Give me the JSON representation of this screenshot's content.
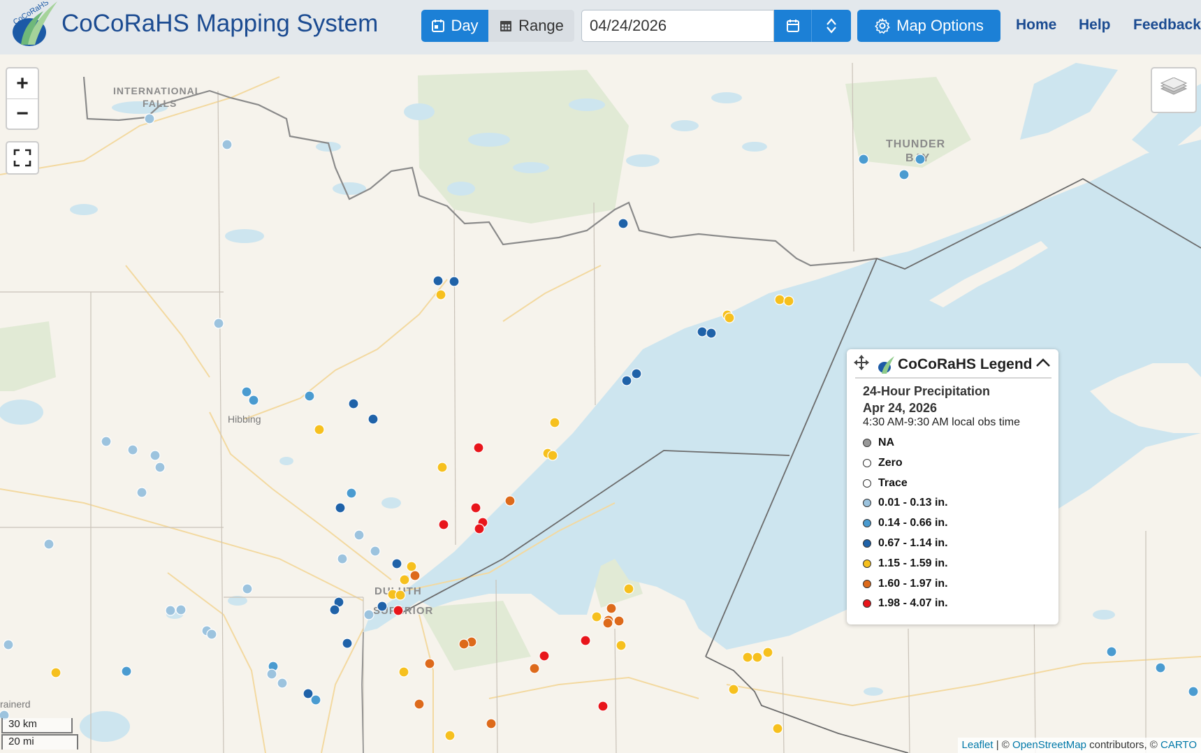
{
  "header": {
    "app_title": "CoCoRaHS Mapping System",
    "day_label": "Day",
    "range_label": "Range",
    "date_value": "04/24/2026",
    "map_options_label": "Map Options",
    "nav": [
      "Home",
      "Help",
      "Feedback"
    ]
  },
  "map": {
    "place_labels": [
      {
        "text": "INTERNATIONAL"
      },
      {
        "text": "FALLS"
      },
      {
        "text": "THUNDER"
      },
      {
        "text": "BAY"
      },
      {
        "text": "Hibbing"
      },
      {
        "text": "DULUTH"
      },
      {
        "text": "SUPERIOR"
      },
      {
        "text": "rainerd"
      }
    ],
    "scale": {
      "km": "30 km",
      "mi": "20 mi"
    },
    "attribution": {
      "leaflet": "Leaflet",
      "sep1": " | © ",
      "osm": "OpenStreetMap",
      "contrib": " contributors, © ",
      "carto": "CARTO"
    }
  },
  "legend": {
    "title": "CoCoRaHS Legend",
    "subtitle": "24-Hour Precipitation",
    "date": "Apr 24, 2026",
    "obs_time": "4:30 AM-9:30 AM local obs time",
    "items": [
      {
        "label": "NA",
        "color": "#999999"
      },
      {
        "label": "Zero",
        "color": "#ffffff"
      },
      {
        "label": "Trace",
        "color": "#ffffff"
      },
      {
        "label": "0.01 - 0.13 in.",
        "color": "#9cc3de"
      },
      {
        "label": "0.14 - 0.66 in.",
        "color": "#4a9bd0"
      },
      {
        "label": "0.67 - 1.14 in.",
        "color": "#1f62a8"
      },
      {
        "label": "1.15 - 1.59 in.",
        "color": "#f6c01e"
      },
      {
        "label": "1.60 - 1.97 in.",
        "color": "#dd6a1b"
      },
      {
        "label": "1.98 - 4.07 in.",
        "color": "#e8151b"
      }
    ]
  },
  "colors": {
    "header_bg": "#e3e8ec",
    "primary": "#1c80d6",
    "title_blue": "#1b4b91",
    "water": "#cde5ef",
    "land": "#f6f3ec"
  }
}
